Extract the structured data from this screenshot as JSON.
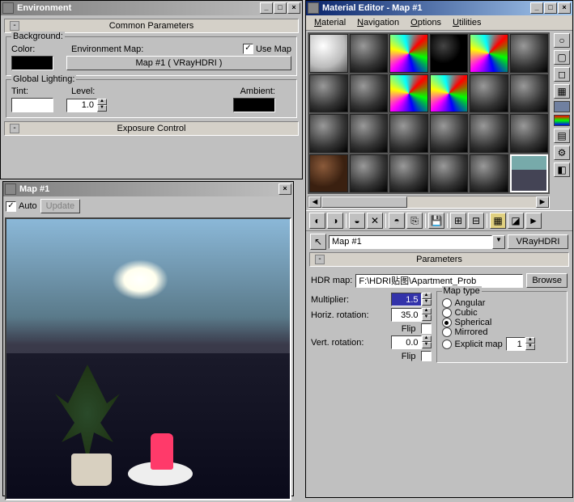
{
  "env_window": {
    "title": "Environment",
    "common_header": "Common Parameters",
    "background_label": "Background:",
    "color_label": "Color:",
    "envmap_label": "Environment Map:",
    "use_map_label": "Use Map",
    "use_map_checked": "✓",
    "map_button": "Map #1  ( VRayHDRI )",
    "global_lighting_label": "Global Lighting:",
    "tint_label": "Tint:",
    "level_label": "Level:",
    "level_value": "1.0",
    "ambient_label": "Ambient:",
    "exposure_header": "Exposure Control"
  },
  "map_window": {
    "title": "Map #1",
    "auto_label": "Auto",
    "auto_checked": "✓",
    "update_btn": "Update"
  },
  "mat_editor": {
    "title": "Material Editor - Map #1",
    "menus": {
      "material": "Material",
      "navigation": "Navigation",
      "options": "Options",
      "utilities": "Utilities"
    },
    "name_value": "Map #1",
    "type_btn": "VRayHDRI",
    "params_header": "Parameters",
    "hdrmap_label": "HDR map:",
    "hdrmap_value": "F:\\HDRI贴图\\Apartment_Prob",
    "browse_btn": "Browse",
    "multiplier_label": "Multiplier:",
    "multiplier_value": "1.5",
    "hrot_label": "Horiz. rotation:",
    "hrot_value": "35.0",
    "flip_label": "Flip",
    "vrot_label": "Vert. rotation:",
    "vrot_value": "0.0",
    "maptype_label": "Map type",
    "radio_angular": "Angular",
    "radio_cubic": "Cubic",
    "radio_spherical": "Spherical",
    "radio_mirrored": "Mirrored",
    "radio_explicit": "Explicit map",
    "explicit_value": "1",
    "side_icons": {
      "sphere": "○",
      "cyl": "▢",
      "cube": "◻",
      "check": "▦",
      "blue": "",
      "mag": "",
      "rgb": "",
      "film": "▤",
      "opts": "⚙",
      "sel": "◧"
    },
    "tools": {
      "get": "◐",
      "put": "◑",
      "x": "✕",
      "asgn": "◒",
      "reset": "◓",
      "clone": "⎘",
      "save": "💾",
      "nav1": "⊞",
      "nav2": "⊟",
      "go": "►",
      "sib": "▦",
      "show": "◪"
    }
  }
}
